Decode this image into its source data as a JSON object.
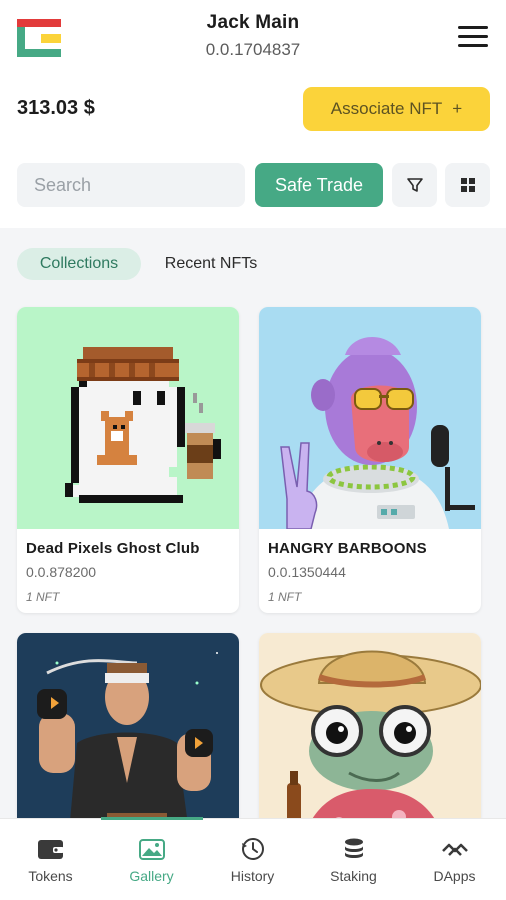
{
  "account": {
    "name": "Jack Main",
    "id": "0.0.1704837"
  },
  "balance": "313.03 $",
  "associate": {
    "label": "Associate NFT",
    "plus": "+"
  },
  "search": {
    "placeholder": "Search"
  },
  "safe_trade": "Safe Trade",
  "tabs": [
    {
      "label": "Collections",
      "active": true
    },
    {
      "label": "Recent NFTs",
      "active": false
    }
  ],
  "collections": [
    {
      "name": "Dead Pixels Ghost Club",
      "id": "0.0.878200",
      "count": "1 NFT"
    },
    {
      "name": "HANGRY BARBOONS",
      "id": "0.0.1350444",
      "count": "1 NFT"
    }
  ],
  "nav": [
    {
      "label": "Tokens",
      "icon": "wallet-icon"
    },
    {
      "label": "Gallery",
      "icon": "gallery-icon",
      "active": true
    },
    {
      "label": "History",
      "icon": "history-icon"
    },
    {
      "label": "Staking",
      "icon": "staking-icon"
    },
    {
      "label": "DApps",
      "icon": "dapps-icon"
    }
  ],
  "colors": {
    "accent": "#46a985",
    "yellow": "#fbd33a",
    "pill_bg": "#dbeee6"
  }
}
